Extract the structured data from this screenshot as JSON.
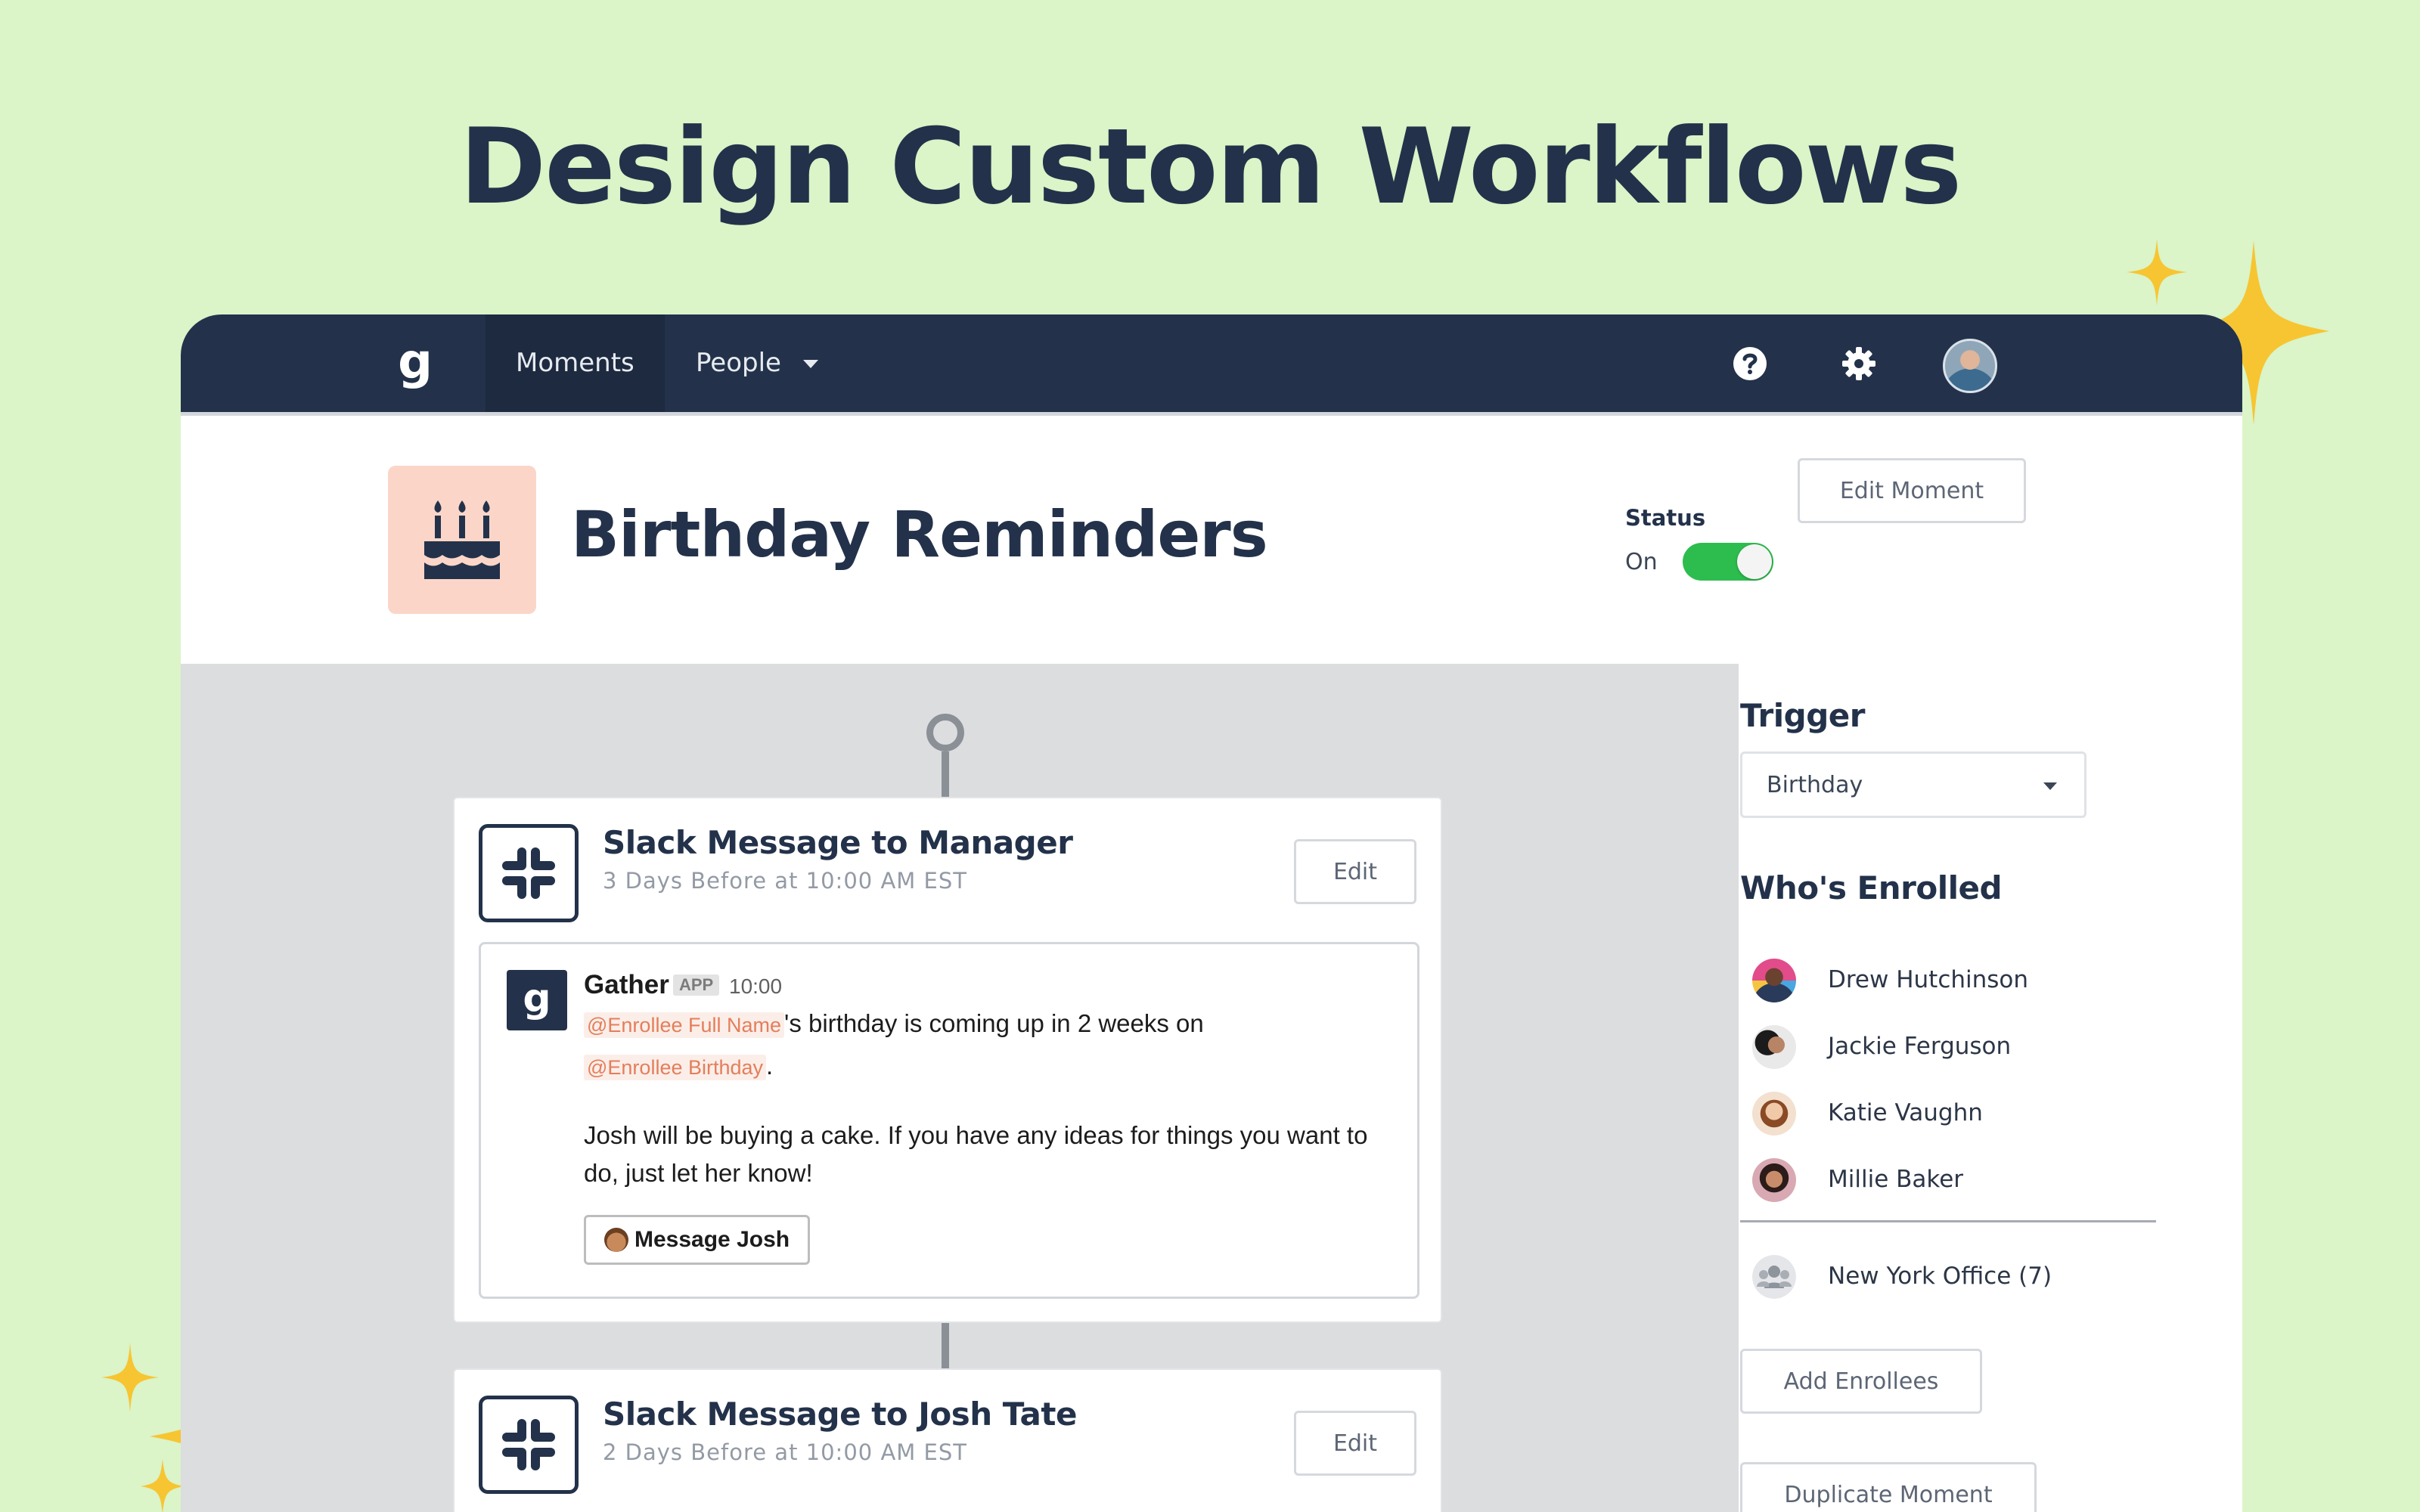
{
  "headline": "Design Custom Workflows",
  "colors": {
    "background": "#dbf4c8",
    "navbar": "#23324a",
    "accent_toggle": "#2dbd4e",
    "mention": "#e47e5b",
    "moment_icon_bg": "#fbd6c8",
    "sparkle": "#f7c531"
  },
  "navbar": {
    "logo": "g",
    "tabs": [
      {
        "label": "Moments",
        "active": true
      },
      {
        "label": "People",
        "has_dropdown": true
      }
    ],
    "icons": [
      "help-icon",
      "gear-icon",
      "user-avatar"
    ]
  },
  "moment": {
    "icon": "birthday-cake-icon",
    "title": "Birthday Reminders",
    "status_label": "Status",
    "status_value": "On",
    "status_on": true,
    "edit_label": "Edit Moment"
  },
  "steps": [
    {
      "title": "Slack Message to Manager",
      "subtitle": "3 Days Before at 10:00 AM EST",
      "edit_label": "Edit",
      "icon": "slack-icon",
      "preview": {
        "sender": "Gather",
        "badge": "APP",
        "time": "10:00",
        "mention_name": "@Enrollee Full Name",
        "line1_rest": "'s birthday is coming up in 2 weeks on",
        "mention_birthday": "@Enrollee Birthday",
        "line2_rest": ".",
        "para_line1": "Josh will be buying a cake. If you have any ideas for things you want to",
        "para_line2": "do, just let her know!",
        "button_label": "Message Josh"
      }
    },
    {
      "title": "Slack Message to Josh Tate",
      "subtitle": "2 Days Before at 10:00 AM EST",
      "edit_label": "Edit",
      "icon": "slack-icon"
    }
  ],
  "sidebar": {
    "trigger_heading": "Trigger",
    "trigger_value": "Birthday",
    "enrolled_heading": "Who's Enrolled",
    "enrollees": [
      {
        "name": "Drew Hutchinson"
      },
      {
        "name": "Jackie Ferguson"
      },
      {
        "name": "Katie Vaughn"
      },
      {
        "name": "Millie Baker"
      }
    ],
    "group": {
      "name": "New York Office (7)"
    },
    "add_label": "Add Enrollees",
    "duplicate_label": "Duplicate Moment"
  }
}
